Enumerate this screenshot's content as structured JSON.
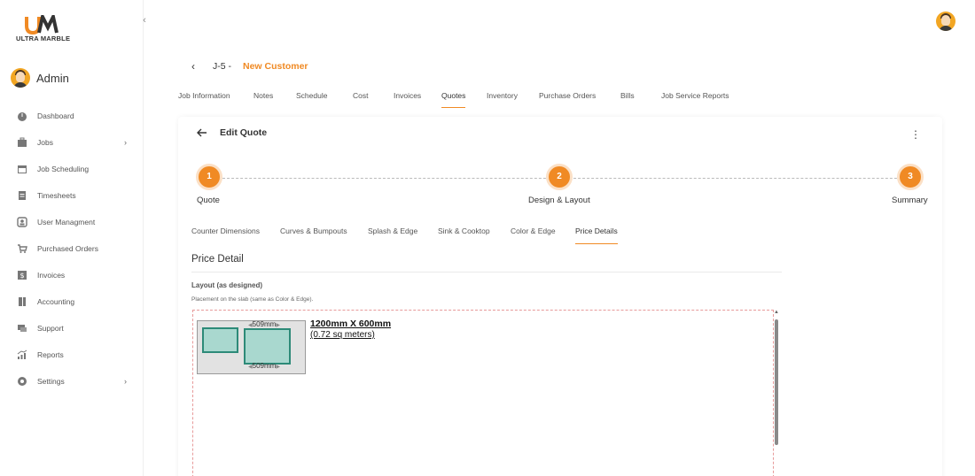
{
  "brand": {
    "logo_text": "ULTRA MARBLE",
    "accent_color": "#f08a24"
  },
  "sidebar": {
    "collapse_icon": "chevron-left-icon",
    "user_label": "Admin",
    "items": [
      {
        "label": "Dashboard",
        "icon": "dashboard-icon",
        "has_submenu": false
      },
      {
        "label": "Jobs",
        "icon": "briefcase-icon",
        "has_submenu": true
      },
      {
        "label": "Job Scheduling",
        "icon": "calendar-icon",
        "has_submenu": false
      },
      {
        "label": "Timesheets",
        "icon": "document-icon",
        "has_submenu": false
      },
      {
        "label": "User Managment",
        "icon": "user-card-icon",
        "has_submenu": false
      },
      {
        "label": "Purchased Orders",
        "icon": "cart-icon",
        "has_submenu": false
      },
      {
        "label": "Invoices",
        "icon": "dollar-icon",
        "has_submenu": false
      },
      {
        "label": "Accounting",
        "icon": "ledger-icon",
        "has_submenu": false
      },
      {
        "label": "Support",
        "icon": "support-icon",
        "has_submenu": false
      },
      {
        "label": "Reports",
        "icon": "chart-icon",
        "has_submenu": false
      },
      {
        "label": "Settings",
        "icon": "gear-icon",
        "has_submenu": true
      }
    ]
  },
  "header": {
    "job_id": "J-5 -",
    "customer_name": "New Customer",
    "tabs": [
      {
        "label": "Job Information",
        "active": false
      },
      {
        "label": "Notes",
        "active": false
      },
      {
        "label": "Schedule",
        "active": false
      },
      {
        "label": "Cost",
        "active": false
      },
      {
        "label": "Invoices",
        "active": false
      },
      {
        "label": "Quotes",
        "active": true
      },
      {
        "label": "Inventory",
        "active": false
      },
      {
        "label": "Purchase Orders",
        "active": false
      },
      {
        "label": "Bills",
        "active": false
      },
      {
        "label": "Job Service Reports",
        "active": false
      }
    ]
  },
  "quote": {
    "title": "Edit Quote",
    "steps": [
      {
        "number": "1",
        "label": "Quote"
      },
      {
        "number": "2",
        "label": "Design & Layout"
      },
      {
        "number": "3",
        "label": "Summary"
      }
    ],
    "subtabs": [
      {
        "label": "Counter Dimensions",
        "active": false
      },
      {
        "label": "Curves & Bumpouts",
        "active": false
      },
      {
        "label": "Splash & Edge",
        "active": false
      },
      {
        "label": "Sink & Cooktop",
        "active": false
      },
      {
        "label": "Color & Edge",
        "active": false
      },
      {
        "label": "Price Details",
        "active": true
      }
    ],
    "section_title": "Price Detail",
    "layout_label": "Layout (as designed)",
    "layout_help": "Placement on the slab (same as Color & Edge).",
    "slab": {
      "dimension_top": "509mm",
      "dimension_bottom": "509mm",
      "size_label": "1200mm X 600mm",
      "area_label": "(0.72 sq meters)"
    }
  }
}
